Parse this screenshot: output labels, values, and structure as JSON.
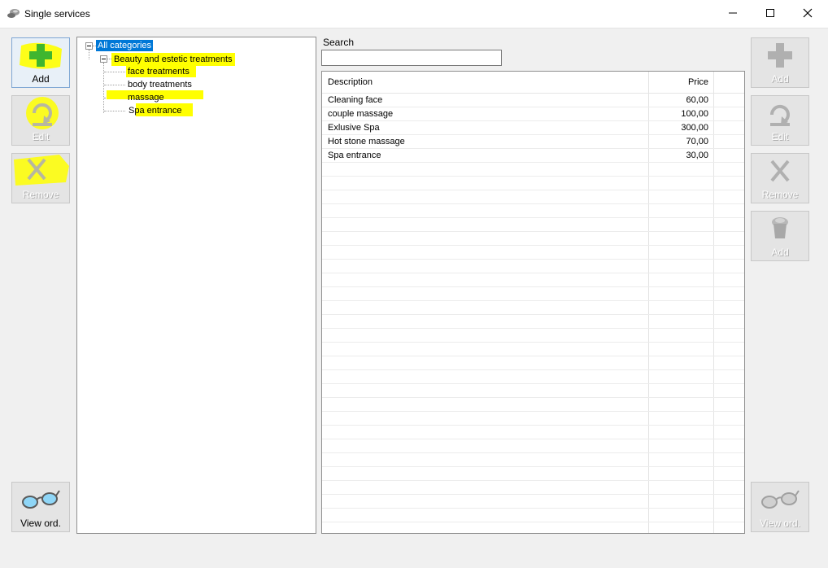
{
  "window": {
    "title": "Single services",
    "controls": [
      "minimize-icon",
      "maximize-icon",
      "close-icon"
    ]
  },
  "left_toolbar": {
    "add_label": "Add",
    "edit_label": "Edit",
    "remove_label": "Remove",
    "view_orders_label": "View ord."
  },
  "right_toolbar": {
    "add_label": "Add",
    "edit_label": "Edit",
    "remove_label": "Remove",
    "add_item_label": "Add",
    "view_orders_label": "View ord."
  },
  "tree": {
    "root": "All categories",
    "category": "Beauty and estetic treatments",
    "children": [
      "face treatments",
      "body treatments",
      "massage",
      "Spa entrance"
    ]
  },
  "search": {
    "label": "Search",
    "value": ""
  },
  "grid": {
    "columns": [
      "Description",
      "Price"
    ],
    "rows": [
      {
        "description": "Cleaning face",
        "price": "60,00"
      },
      {
        "description": "couple massage",
        "price": "100,00"
      },
      {
        "description": "Exlusive Spa",
        "price": "300,00"
      },
      {
        "description": "Hot stone massage",
        "price": "70,00"
      },
      {
        "description": "Spa entrance",
        "price": "30,00"
      }
    ]
  },
  "colors": {
    "highlight": "#ffff00",
    "selection": "#0078d7",
    "add_green": "#3fb62f"
  }
}
